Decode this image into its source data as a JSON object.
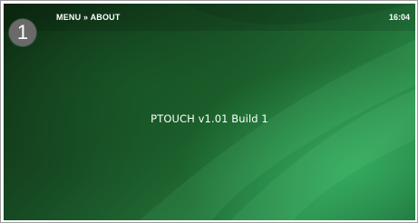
{
  "header": {
    "step_number": "1",
    "breadcrumb": "MENU » ABOUT",
    "time": "16:04"
  },
  "main": {
    "version_text": "PTOUCH v1.01 Build 1"
  },
  "colors": {
    "background_dark": "#0d2a12",
    "background_light": "#2b8f4c",
    "text": "#ffffff",
    "badge": "#6a6a6a"
  }
}
